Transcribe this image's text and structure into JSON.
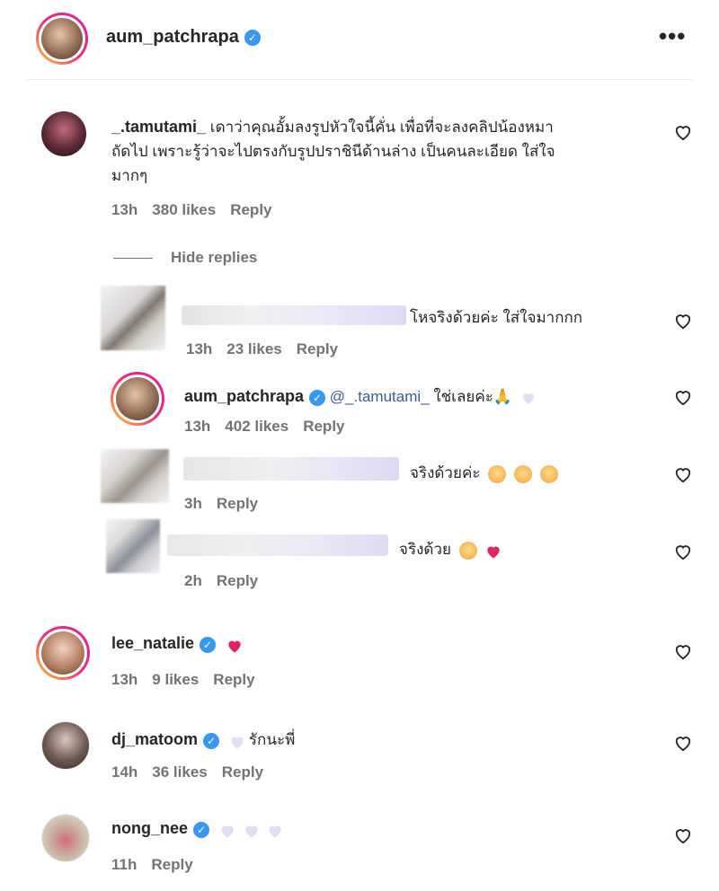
{
  "post": {
    "author": "aum_patchrapa",
    "more_icon": "more-horizontal-icon"
  },
  "comments": {
    "c1": {
      "username": "_.tamutami_",
      "text_line1": "เดาว่าคุณอั้มลงรูปหัวใจนี้คั่น เพื่อที่จะลงคลิปน้องหมา",
      "text_line2": "ถัดไป เพราะรู้ว่าจะไปตรงกับรูปปราชินีด้านล่าง เป็นคนละเอียด ใส่ใจ",
      "text_line3": "มากๆ",
      "time": "13h",
      "likes": "380 likes",
      "reply": "Reply",
      "hide_replies": "Hide replies"
    },
    "r1": {
      "text": "โหจริงด้วยค่ะ ใส่ใจมากกก",
      "time": "13h",
      "likes": "23 likes",
      "reply": "Reply"
    },
    "r2": {
      "username": "aum_patchrapa",
      "mention": "@_.tamutami_",
      "text": "ใช่เลยค่ะ",
      "time": "13h",
      "likes": "402 likes",
      "reply": "Reply"
    },
    "r3": {
      "text": "จริงด้วยค่ะ",
      "time": "3h",
      "reply": "Reply"
    },
    "r4": {
      "text": "จริงด้วย",
      "time": "2h",
      "reply": "Reply"
    },
    "c2": {
      "username": "lee_natalie",
      "time": "13h",
      "likes": "9 likes",
      "reply": "Reply"
    },
    "c3": {
      "username": "dj_matoom",
      "text": "รักนะพี่",
      "time": "14h",
      "likes": "36 likes",
      "reply": "Reply"
    },
    "c4": {
      "username": "nong_nee",
      "time": "11h",
      "reply": "Reply"
    }
  },
  "colors": {
    "verified": "#3897f0",
    "heart_red": "#e0245e",
    "meta_gray": "#737373"
  }
}
